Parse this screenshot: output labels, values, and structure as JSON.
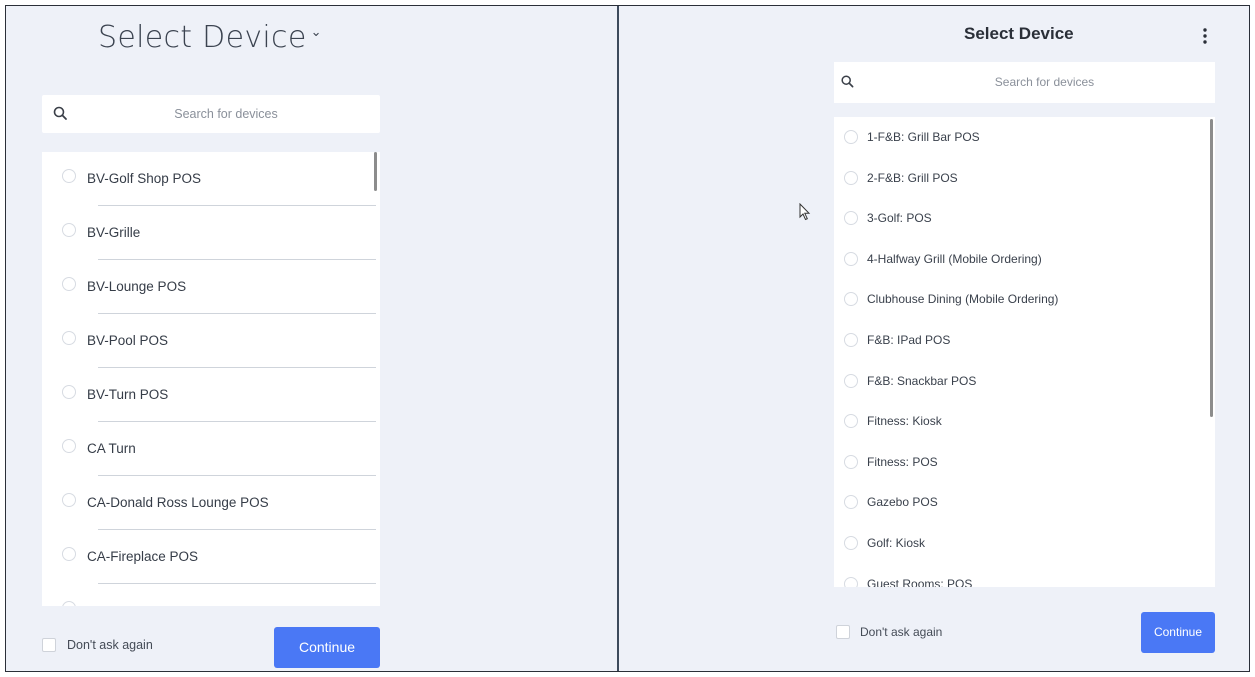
{
  "left_panel": {
    "title": "Select Device",
    "title_dropdown_icon": "chevron-down-icon",
    "search": {
      "placeholder": "Search for devices",
      "icon": "search-icon"
    },
    "devices": [
      "BV-Golf Shop POS",
      "BV-Grille",
      "BV-Lounge POS",
      "BV-Pool POS",
      "BV-Turn POS",
      "CA Turn",
      "CA-Donald Ross Lounge POS",
      "CA-Fireplace POS"
    ],
    "dont_ask_label": "Don't ask again",
    "dont_ask_checked": false,
    "continue_label": "Continue"
  },
  "right_panel": {
    "title": "Select Device",
    "menu_icon": "more-vertical-icon",
    "search": {
      "placeholder": "Search for devices",
      "icon": "search-icon"
    },
    "devices": [
      "1-F&B: Grill Bar POS",
      "2-F&B: Grill POS",
      "3-Golf: POS",
      "4-Halfway Grill (Mobile Ordering)",
      "Clubhouse Dining (Mobile Ordering)",
      "F&B: IPad POS",
      "F&B: Snackbar POS",
      "Fitness: Kiosk",
      "Fitness: POS",
      "Gazebo POS",
      "Golf: Kiosk",
      "Guest Rooms: POS"
    ],
    "dont_ask_label": "Don't ask again",
    "dont_ask_checked": false,
    "continue_label": "Continue"
  },
  "colors": {
    "background": "#eef1f8",
    "accent": "#4a78f5",
    "divider": "#3d4a5c"
  }
}
